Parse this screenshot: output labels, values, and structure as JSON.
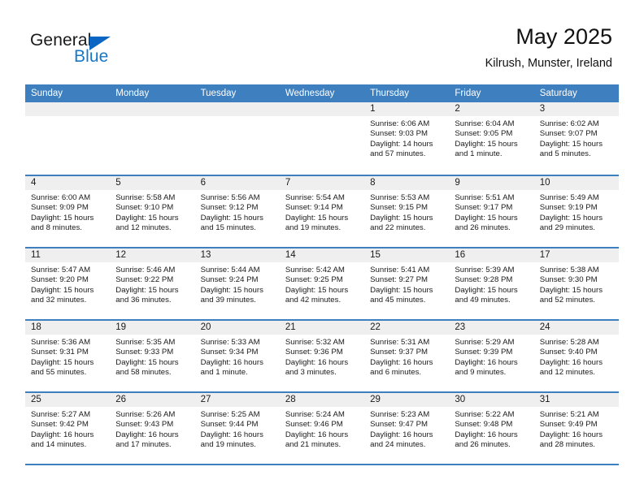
{
  "brand": {
    "name_top": "General",
    "name_bottom": "Blue",
    "accent_color": "#0a66c2",
    "text_color": "#1878c8",
    "logo_icon": "triangle-logo-icon"
  },
  "header": {
    "title": "May 2025",
    "location": "Kilrush, Munster, Ireland"
  },
  "theme": {
    "header_blue": "#3d7fbf",
    "daynum_band": "#efefef",
    "text": "#1a1a1a"
  },
  "weekdays": [
    "Sunday",
    "Monday",
    "Tuesday",
    "Wednesday",
    "Thursday",
    "Friday",
    "Saturday"
  ],
  "weeks": [
    [
      {
        "day": "",
        "empty": true,
        "lines": []
      },
      {
        "day": "",
        "empty": true,
        "lines": []
      },
      {
        "day": "",
        "empty": true,
        "lines": []
      },
      {
        "day": "",
        "empty": true,
        "lines": []
      },
      {
        "day": "1",
        "lines": [
          "Sunrise: 6:06 AM",
          "Sunset: 9:03 PM",
          "Daylight: 14 hours",
          "and 57 minutes."
        ]
      },
      {
        "day": "2",
        "lines": [
          "Sunrise: 6:04 AM",
          "Sunset: 9:05 PM",
          "Daylight: 15 hours",
          "and 1 minute."
        ]
      },
      {
        "day": "3",
        "lines": [
          "Sunrise: 6:02 AM",
          "Sunset: 9:07 PM",
          "Daylight: 15 hours",
          "and 5 minutes."
        ]
      }
    ],
    [
      {
        "day": "4",
        "lines": [
          "Sunrise: 6:00 AM",
          "Sunset: 9:09 PM",
          "Daylight: 15 hours",
          "and 8 minutes."
        ]
      },
      {
        "day": "5",
        "lines": [
          "Sunrise: 5:58 AM",
          "Sunset: 9:10 PM",
          "Daylight: 15 hours",
          "and 12 minutes."
        ]
      },
      {
        "day": "6",
        "lines": [
          "Sunrise: 5:56 AM",
          "Sunset: 9:12 PM",
          "Daylight: 15 hours",
          "and 15 minutes."
        ]
      },
      {
        "day": "7",
        "lines": [
          "Sunrise: 5:54 AM",
          "Sunset: 9:14 PM",
          "Daylight: 15 hours",
          "and 19 minutes."
        ]
      },
      {
        "day": "8",
        "lines": [
          "Sunrise: 5:53 AM",
          "Sunset: 9:15 PM",
          "Daylight: 15 hours",
          "and 22 minutes."
        ]
      },
      {
        "day": "9",
        "lines": [
          "Sunrise: 5:51 AM",
          "Sunset: 9:17 PM",
          "Daylight: 15 hours",
          "and 26 minutes."
        ]
      },
      {
        "day": "10",
        "lines": [
          "Sunrise: 5:49 AM",
          "Sunset: 9:19 PM",
          "Daylight: 15 hours",
          "and 29 minutes."
        ]
      }
    ],
    [
      {
        "day": "11",
        "lines": [
          "Sunrise: 5:47 AM",
          "Sunset: 9:20 PM",
          "Daylight: 15 hours",
          "and 32 minutes."
        ]
      },
      {
        "day": "12",
        "lines": [
          "Sunrise: 5:46 AM",
          "Sunset: 9:22 PM",
          "Daylight: 15 hours",
          "and 36 minutes."
        ]
      },
      {
        "day": "13",
        "lines": [
          "Sunrise: 5:44 AM",
          "Sunset: 9:24 PM",
          "Daylight: 15 hours",
          "and 39 minutes."
        ]
      },
      {
        "day": "14",
        "lines": [
          "Sunrise: 5:42 AM",
          "Sunset: 9:25 PM",
          "Daylight: 15 hours",
          "and 42 minutes."
        ]
      },
      {
        "day": "15",
        "lines": [
          "Sunrise: 5:41 AM",
          "Sunset: 9:27 PM",
          "Daylight: 15 hours",
          "and 45 minutes."
        ]
      },
      {
        "day": "16",
        "lines": [
          "Sunrise: 5:39 AM",
          "Sunset: 9:28 PM",
          "Daylight: 15 hours",
          "and 49 minutes."
        ]
      },
      {
        "day": "17",
        "lines": [
          "Sunrise: 5:38 AM",
          "Sunset: 9:30 PM",
          "Daylight: 15 hours",
          "and 52 minutes."
        ]
      }
    ],
    [
      {
        "day": "18",
        "lines": [
          "Sunrise: 5:36 AM",
          "Sunset: 9:31 PM",
          "Daylight: 15 hours",
          "and 55 minutes."
        ]
      },
      {
        "day": "19",
        "lines": [
          "Sunrise: 5:35 AM",
          "Sunset: 9:33 PM",
          "Daylight: 15 hours",
          "and 58 minutes."
        ]
      },
      {
        "day": "20",
        "lines": [
          "Sunrise: 5:33 AM",
          "Sunset: 9:34 PM",
          "Daylight: 16 hours",
          "and 1 minute."
        ]
      },
      {
        "day": "21",
        "lines": [
          "Sunrise: 5:32 AM",
          "Sunset: 9:36 PM",
          "Daylight: 16 hours",
          "and 3 minutes."
        ]
      },
      {
        "day": "22",
        "lines": [
          "Sunrise: 5:31 AM",
          "Sunset: 9:37 PM",
          "Daylight: 16 hours",
          "and 6 minutes."
        ]
      },
      {
        "day": "23",
        "lines": [
          "Sunrise: 5:29 AM",
          "Sunset: 9:39 PM",
          "Daylight: 16 hours",
          "and 9 minutes."
        ]
      },
      {
        "day": "24",
        "lines": [
          "Sunrise: 5:28 AM",
          "Sunset: 9:40 PM",
          "Daylight: 16 hours",
          "and 12 minutes."
        ]
      }
    ],
    [
      {
        "day": "25",
        "lines": [
          "Sunrise: 5:27 AM",
          "Sunset: 9:42 PM",
          "Daylight: 16 hours",
          "and 14 minutes."
        ]
      },
      {
        "day": "26",
        "lines": [
          "Sunrise: 5:26 AM",
          "Sunset: 9:43 PM",
          "Daylight: 16 hours",
          "and 17 minutes."
        ]
      },
      {
        "day": "27",
        "lines": [
          "Sunrise: 5:25 AM",
          "Sunset: 9:44 PM",
          "Daylight: 16 hours",
          "and 19 minutes."
        ]
      },
      {
        "day": "28",
        "lines": [
          "Sunrise: 5:24 AM",
          "Sunset: 9:46 PM",
          "Daylight: 16 hours",
          "and 21 minutes."
        ]
      },
      {
        "day": "29",
        "lines": [
          "Sunrise: 5:23 AM",
          "Sunset: 9:47 PM",
          "Daylight: 16 hours",
          "and 24 minutes."
        ]
      },
      {
        "day": "30",
        "lines": [
          "Sunrise: 5:22 AM",
          "Sunset: 9:48 PM",
          "Daylight: 16 hours",
          "and 26 minutes."
        ]
      },
      {
        "day": "31",
        "lines": [
          "Sunrise: 5:21 AM",
          "Sunset: 9:49 PM",
          "Daylight: 16 hours",
          "and 28 minutes."
        ]
      }
    ]
  ]
}
